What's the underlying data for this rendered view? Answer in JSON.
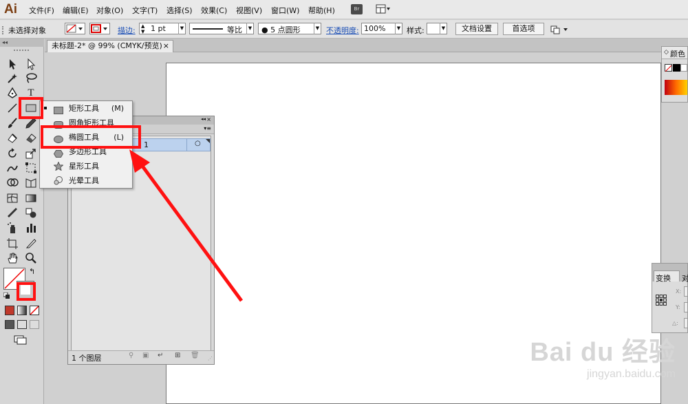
{
  "app": {
    "logo": "Ai"
  },
  "menu": {
    "items": [
      "文件(F)",
      "编辑(E)",
      "对象(O)",
      "文字(T)",
      "选择(S)",
      "效果(C)",
      "视图(V)",
      "窗口(W)",
      "帮助(H)"
    ],
    "br": "Br"
  },
  "control": {
    "no_selection": "未选择对象",
    "stroke_label": "描边:",
    "stroke_value": "1 pt",
    "stroke_style": "等比",
    "brush": "● 5 点圆形",
    "opacity_label": "不透明度:",
    "opacity_value": "100%",
    "style_label": "样式:",
    "doc_setup": "文档设置",
    "preferences": "首选项"
  },
  "document": {
    "tab_title": "未标题-2* @ 99% (CMYK/预览)",
    "close": "×"
  },
  "flyout": {
    "items": [
      {
        "label": "矩形工具",
        "shortcut": "(M)",
        "icon": "rect-icon"
      },
      {
        "label": "圆角矩形工具",
        "shortcut": "",
        "icon": "rounded-rect-icon"
      },
      {
        "label": "椭圆工具",
        "shortcut": "(L)",
        "icon": "ellipse-icon"
      },
      {
        "label": "多边形工具",
        "shortcut": "",
        "icon": "polygon-icon"
      },
      {
        "label": "星形工具",
        "shortcut": "",
        "icon": "star-icon"
      },
      {
        "label": "光晕工具",
        "shortcut": "",
        "icon": "flare-icon"
      }
    ]
  },
  "layers": {
    "row_label": "1",
    "footer": "1 个图层"
  },
  "panels": {
    "color_title": "颜色",
    "transform_title": "变换",
    "transform_tab2": "对",
    "x_label": "X:",
    "y_label": "Y:",
    "angle_label": "△:"
  },
  "watermark": {
    "brand": "Bai  du 经验",
    "url": "jingyan.baidu.com"
  },
  "colors": {
    "highlight": "#ff1111",
    "arrow": "#ff1111",
    "link": "#1b4fb6",
    "logo": "#7a3c10"
  }
}
